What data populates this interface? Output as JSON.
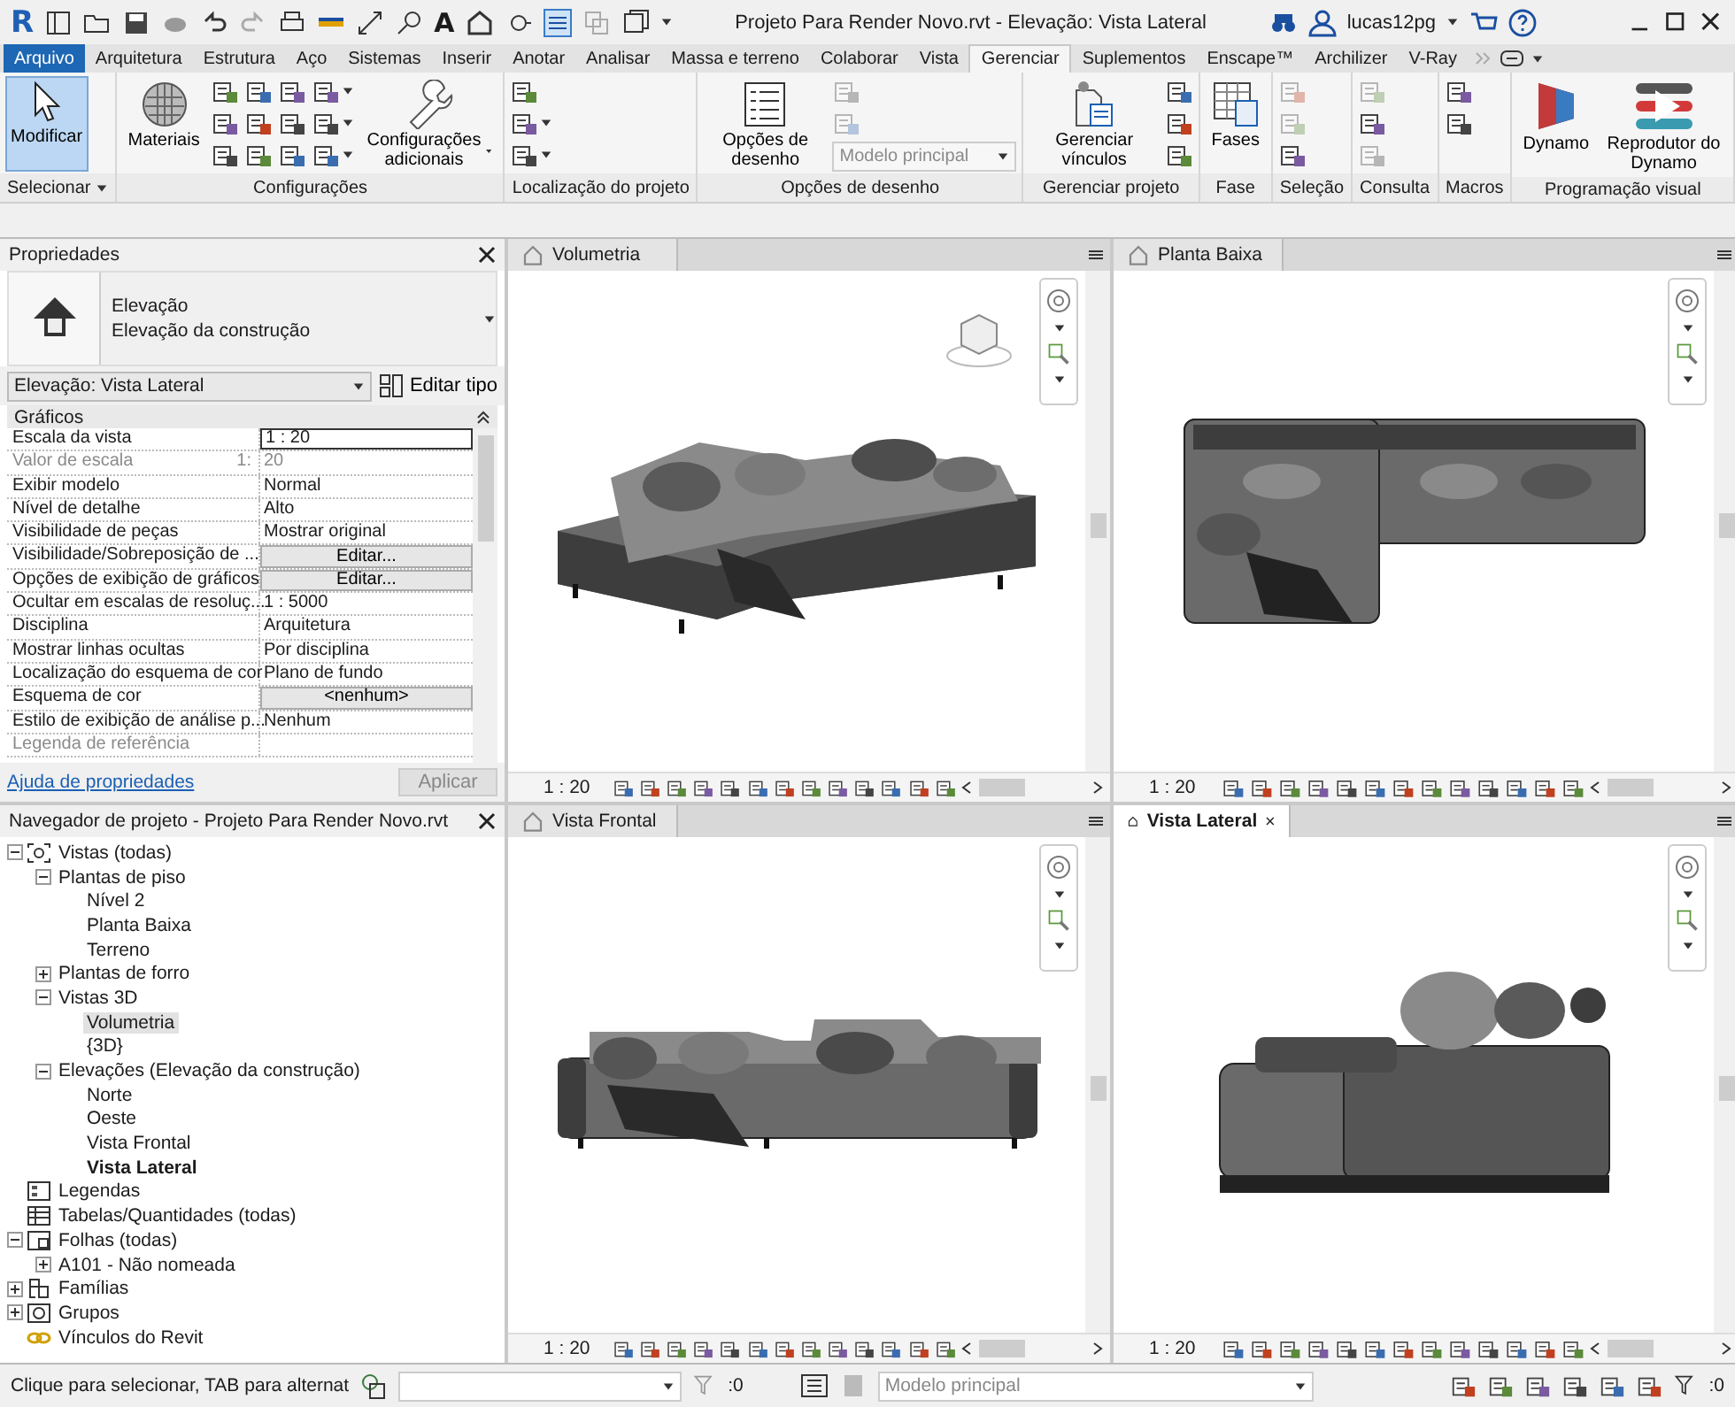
{
  "window": {
    "logo": "R",
    "text_tool": "A",
    "title": "Projeto Para Render Novo.rvt - Elevação: Vista Lateral",
    "user": "lucas12pg"
  },
  "ribbon_tabs": [
    {
      "label": "Arquivo",
      "kind": "file",
      "selected": false
    },
    {
      "label": "Arquitetura",
      "kind": "tab",
      "selected": false
    },
    {
      "label": "Estrutura",
      "kind": "tab",
      "selected": false
    },
    {
      "label": "Aço",
      "kind": "tab",
      "selected": false
    },
    {
      "label": "Sistemas",
      "kind": "tab",
      "selected": false
    },
    {
      "label": "Inserir",
      "kind": "tab",
      "selected": false
    },
    {
      "label": "Anotar",
      "kind": "tab",
      "selected": false
    },
    {
      "label": "Analisar",
      "kind": "tab",
      "selected": false
    },
    {
      "label": "Massa e terreno",
      "kind": "tab",
      "selected": false
    },
    {
      "label": "Colaborar",
      "kind": "tab",
      "selected": false
    },
    {
      "label": "Vista",
      "kind": "tab",
      "selected": false
    },
    {
      "label": "Gerenciar",
      "kind": "tab",
      "selected": true
    },
    {
      "label": "Suplementos",
      "kind": "tab",
      "selected": false
    },
    {
      "label": "Enscape™",
      "kind": "tab",
      "selected": false
    },
    {
      "label": "Archilizer",
      "kind": "tab",
      "selected": false
    },
    {
      "label": "V-Ray",
      "kind": "tab",
      "selected": false
    }
  ],
  "ribbon_panels": [
    {
      "title": "Selecionar",
      "has_menu": true,
      "items": [
        {
          "kind": "modify",
          "label": "Modificar",
          "pressed": true,
          "has_menu": false
        }
      ]
    },
    {
      "title": "Configurações",
      "has_menu": false,
      "items": [
        {
          "kind": "materials",
          "label": "Materiais",
          "pressed": false,
          "has_menu": false
        },
        {
          "kind": "tools",
          "tools": [
            {
              "disabled": false,
              "menu": false
            },
            {
              "disabled": false,
              "menu": false
            },
            {
              "disabled": false,
              "menu": false
            },
            {
              "disabled": false,
              "menu": false
            },
            {
              "disabled": false,
              "menu": false
            },
            {
              "disabled": false,
              "menu": false
            },
            {
              "disabled": false,
              "menu": false
            },
            {
              "disabled": false,
              "menu": false
            },
            {
              "disabled": false,
              "menu": false
            }
          ]
        },
        {
          "kind": "tools",
          "tools": [
            {
              "disabled": false,
              "menu": true
            },
            {
              "disabled": false,
              "menu": true
            },
            {
              "disabled": false,
              "menu": true
            }
          ]
        },
        {
          "kind": "settings",
          "label": "Configurações adicionais",
          "pressed": false,
          "has_menu": true
        }
      ]
    },
    {
      "title": "Localização do projeto",
      "has_menu": false,
      "items": [
        {
          "kind": "tools",
          "tools": [
            {
              "disabled": false,
              "menu": false
            },
            {
              "disabled": false,
              "menu": true
            },
            {
              "disabled": false,
              "menu": true
            }
          ]
        }
      ]
    },
    {
      "title": "Opções de desenho",
      "has_menu": false,
      "items": [
        {
          "kind": "options",
          "label": "Opções de desenho",
          "pressed": false,
          "has_menu": false
        },
        {
          "kind": "tools",
          "tools": [
            {
              "disabled": true,
              "menu": false
            },
            {
              "disabled": true,
              "menu": false
            }
          ],
          "select": {
            "value": "Modelo principal",
            "disabled": true
          }
        }
      ]
    },
    {
      "title": "Gerenciar projeto",
      "has_menu": false,
      "items": [
        {
          "kind": "links",
          "label": "Gerenciar vínculos",
          "pressed": false,
          "has_menu": false
        },
        {
          "kind": "tools",
          "tools": [
            {
              "disabled": false,
              "menu": false
            },
            {
              "disabled": false,
              "menu": false
            },
            {
              "disabled": false,
              "menu": false
            }
          ]
        }
      ]
    },
    {
      "title": "Fase",
      "has_menu": false,
      "items": [
        {
          "kind": "phases",
          "label": "Fases",
          "pressed": false,
          "has_menu": false
        }
      ]
    },
    {
      "title": "Seleção",
      "has_menu": false,
      "items": [
        {
          "kind": "tools",
          "tools": [
            {
              "disabled": true,
              "menu": false
            },
            {
              "disabled": true,
              "menu": false
            },
            {
              "disabled": false,
              "menu": false
            }
          ]
        }
      ]
    },
    {
      "title": "Consulta",
      "has_menu": false,
      "items": [
        {
          "kind": "tools",
          "tools": [
            {
              "disabled": true,
              "menu": false
            },
            {
              "disabled": false,
              "menu": false
            },
            {
              "disabled": true,
              "menu": false
            }
          ]
        }
      ]
    },
    {
      "title": "Macros",
      "has_menu": false,
      "items": [
        {
          "kind": "tools",
          "tools": [
            {
              "disabled": false,
              "menu": false
            },
            {
              "disabled": false,
              "menu": false
            }
          ]
        }
      ]
    },
    {
      "title": "Programação visual",
      "has_menu": false,
      "items": [
        {
          "kind": "dynamo",
          "label": "Dynamo",
          "pressed": false,
          "has_menu": false
        },
        {
          "kind": "player",
          "label": "Reprodutor do Dynamo",
          "pressed": false,
          "has_menu": false
        }
      ]
    }
  ],
  "properties": {
    "title": "Propriedades",
    "type_name": "Elevação",
    "type_family": "Elevação da construção",
    "instance": "Elevação: Vista Lateral",
    "edit_type": "Editar tipo",
    "group": "Gráficos",
    "rows": [
      {
        "name": "Escala da vista",
        "value": "1 : 20",
        "kind": "field",
        "disabled": false
      },
      {
        "name": "Valor de escala",
        "suffix": "1:",
        "value": "20",
        "kind": "text",
        "disabled": true
      },
      {
        "name": "Exibir modelo",
        "value": "Normal",
        "kind": "text",
        "disabled": false
      },
      {
        "name": "Nível de detalhe",
        "value": "Alto",
        "kind": "text",
        "disabled": false
      },
      {
        "name": "Visibilidade de peças",
        "value": "Mostrar original",
        "kind": "text",
        "disabled": false
      },
      {
        "name": "Visibilidade/Sobreposição de ...",
        "value": "Editar...",
        "kind": "button",
        "disabled": false
      },
      {
        "name": "Opções de exibição de gráficos",
        "value": "Editar...",
        "kind": "button",
        "disabled": false
      },
      {
        "name": "Ocultar em escalas de resoluç...",
        "value": "1 : 5000",
        "kind": "text",
        "disabled": false
      },
      {
        "name": "Disciplina",
        "value": "Arquitetura",
        "kind": "text",
        "disabled": false
      },
      {
        "name": "Mostrar linhas ocultas",
        "value": "Por disciplina",
        "kind": "text",
        "disabled": false
      },
      {
        "name": "Localização do esquema de cor",
        "value": "Plano de fundo",
        "kind": "text",
        "disabled": false
      },
      {
        "name": "Esquema de cor",
        "value": "<nenhum>",
        "kind": "button",
        "disabled": false
      },
      {
        "name": "Estilo de exibição de análise p...",
        "value": "Nenhum",
        "kind": "text",
        "disabled": false
      },
      {
        "name": "Legenda de referência",
        "disabled": true
      }
    ],
    "help_link": "Ajuda de propriedades",
    "apply": {
      "label": "Aplicar",
      "disabled": true
    }
  },
  "browser": {
    "title": "Navegador de projeto - Projeto Para Render Novo.rvt",
    "tree": [
      {
        "label": "Vistas (todas)",
        "kind": "views",
        "expanded": true,
        "selected": false,
        "children": [
          {
            "label": "Plantas de piso",
            "expanded": true,
            "selected": false,
            "children": [
              {
                "label": "Nível 2",
                "selected": false,
                "current": false
              },
              {
                "label": "Planta Baixa",
                "selected": false,
                "current": false
              },
              {
                "label": "Terreno",
                "selected": false,
                "current": false
              }
            ]
          },
          {
            "label": "Plantas de forro",
            "expanded": false,
            "selected": false
          },
          {
            "label": "Vistas 3D",
            "expanded": true,
            "selected": false,
            "children": [
              {
                "label": "Volumetria",
                "selected": true,
                "current": false
              },
              {
                "label": "{3D}",
                "selected": false,
                "current": false
              }
            ]
          },
          {
            "label": "Elevações (Elevação da construção)",
            "expanded": true,
            "selected": false,
            "children": [
              {
                "label": "Norte",
                "selected": false,
                "current": false
              },
              {
                "label": "Oeste",
                "selected": false,
                "current": false
              },
              {
                "label": "Vista Frontal",
                "selected": false,
                "current": false
              },
              {
                "label": "Vista Lateral",
                "selected": false,
                "current": true
              }
            ]
          }
        ]
      },
      {
        "label": "Legendas",
        "kind": "legends",
        "selected": false
      },
      {
        "label": "Tabelas/Quantidades (todas)",
        "kind": "schedules",
        "selected": false
      },
      {
        "label": "Folhas (todas)",
        "kind": "sheets",
        "expanded": true,
        "selected": false,
        "children": [
          {
            "label": "A101 - Não nomeada",
            "expanded": false,
            "selected": false
          }
        ]
      },
      {
        "label": "Famílias",
        "kind": "families",
        "expanded": false,
        "selected": false
      },
      {
        "label": "Grupos",
        "kind": "groups",
        "expanded": false,
        "selected": false
      },
      {
        "label": "Vínculos do Revit",
        "kind": "links",
        "selected": false
      }
    ]
  },
  "views": [
    {
      "title": "Volumetria",
      "kind": "perspective",
      "active": false,
      "scale": "1 : 20"
    },
    {
      "title": "Planta Baixa",
      "kind": "plan",
      "active": false,
      "scale": "1 : 20"
    },
    {
      "title": "Vista Frontal",
      "kind": "front",
      "active": false,
      "scale": "1 : 20"
    },
    {
      "title": "Vista Lateral",
      "kind": "side",
      "active": true,
      "scale": "1 : 20"
    }
  ],
  "status_bar": {
    "message": "Clique para selecionar, TAB para alternat",
    "selection_count": ":0",
    "model": "Modelo principal",
    "filter_count": ":0"
  }
}
